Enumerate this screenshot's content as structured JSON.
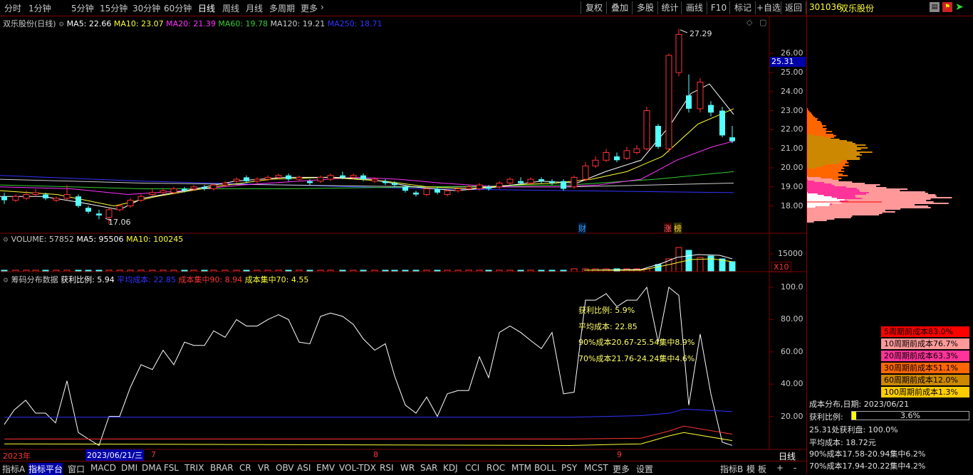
{
  "toolbar": {
    "periods": [
      "分时",
      "1分钟",
      "5分钟",
      "15分钟",
      "30分钟",
      "60分钟",
      "日线",
      "周线",
      "月线",
      "多周期",
      "更多"
    ],
    "active": "日线",
    "buttons": [
      "复权",
      "叠加",
      "多股",
      "统计",
      "画线",
      "F10",
      "标记",
      "+自选",
      "返回"
    ]
  },
  "stock": {
    "code": "301036",
    "name": "双乐股份"
  },
  "main_legend": {
    "title": "双乐股份(日线)",
    "ma5": "MA5: 22.66",
    "ma10": "MA10: 23.07",
    "ma20": "MA20: 21.39",
    "ma60": "MA60: 19.78",
    "ma120": "MA120: 19.21",
    "ma250": "MA250: 18.71"
  },
  "price_axis": [
    "26.00",
    "25.00",
    "24.00",
    "23.00",
    "22.00",
    "21.00",
    "20.00",
    "19.00",
    "18.00"
  ],
  "current_price_tag": "25.31",
  "high_label": "27.29",
  "low_label": "17.06",
  "markers": {
    "cai": "财",
    "zhang": "涨",
    "bang": "榜"
  },
  "volume": {
    "title": "VOLUME: 57852",
    "ma5": "MA5: 95506",
    "ma10": "MA10: 100245",
    "axis": "15000",
    "unit": "X10"
  },
  "chip": {
    "title": "筹码分布数据",
    "profit": "获利比例: 5.94",
    "avg": "平均成本: 22.85",
    "c90": "成本集中90: 8.94",
    "c70": "成本集中70: 4.55",
    "axis": [
      "100.0",
      "80.00",
      "60.00",
      "40.00",
      "20.00"
    ],
    "overlay": [
      "获利比例: 5.9%",
      "平均成本: 22.85",
      "90%成本20.67-25.54集中8.9%",
      "70%成本21.76-24.24集中4.6%"
    ]
  },
  "date_axis": {
    "year": "2023年",
    "cursor_date": "2023/06/21/三",
    "m7": "7",
    "m8": "8",
    "m9": "9",
    "period": "日线"
  },
  "cost_rows": [
    {
      "label": "5周期前成本83.0%",
      "color": "#ff0000"
    },
    {
      "label": "10周期前成本76.7%",
      "color": "#ff9999"
    },
    {
      "label": "20周期前成本63.3%",
      "color": "#ff3399"
    },
    {
      "label": "30周期前成本51.1%",
      "color": "#ff6600"
    },
    {
      "label": "60周期前成本12.0%",
      "color": "#cc8800"
    },
    {
      "label": "100周期前成本1.3%",
      "color": "#ffcc00"
    }
  ],
  "cost_info": {
    "date": "成本分布,日期:  2023/06/21",
    "profit_label": "获利比例:",
    "profit_value": "3.6%",
    "profit_fraction": 0.036,
    "at_price": "25.31处获利盘:  100.0%",
    "avg": "平均成本:  18.72元",
    "c90": "90%成本17.58-20.94集中6.2%",
    "c70": "70%成本17.94-20.22集中4.2%"
  },
  "bottom": {
    "left": [
      "指标A",
      "指标平台",
      "窗口",
      "MACD",
      "DMI",
      "DMA",
      "FSL",
      "TRIX",
      "BRAR",
      "CR",
      "VR",
      "OBV",
      "ASI",
      "EMV",
      "VOL-TDX",
      "RSI",
      "WR",
      "SAR",
      "KDJ",
      "CCI",
      "ROC",
      "MTM",
      "BOLL",
      "PSY",
      "MCST",
      "更多",
      "设置"
    ],
    "right": [
      "指标B",
      "模",
      "板",
      "+",
      "-"
    ]
  },
  "colors": {
    "up": "#ff3333",
    "down": "#54ffff",
    "ma5": "#ffffff",
    "ma10": "#ffff33",
    "ma20": "#ff33ff",
    "ma60": "#33cc33",
    "ma120": "#cccccc",
    "ma250": "#3333ff"
  }
}
